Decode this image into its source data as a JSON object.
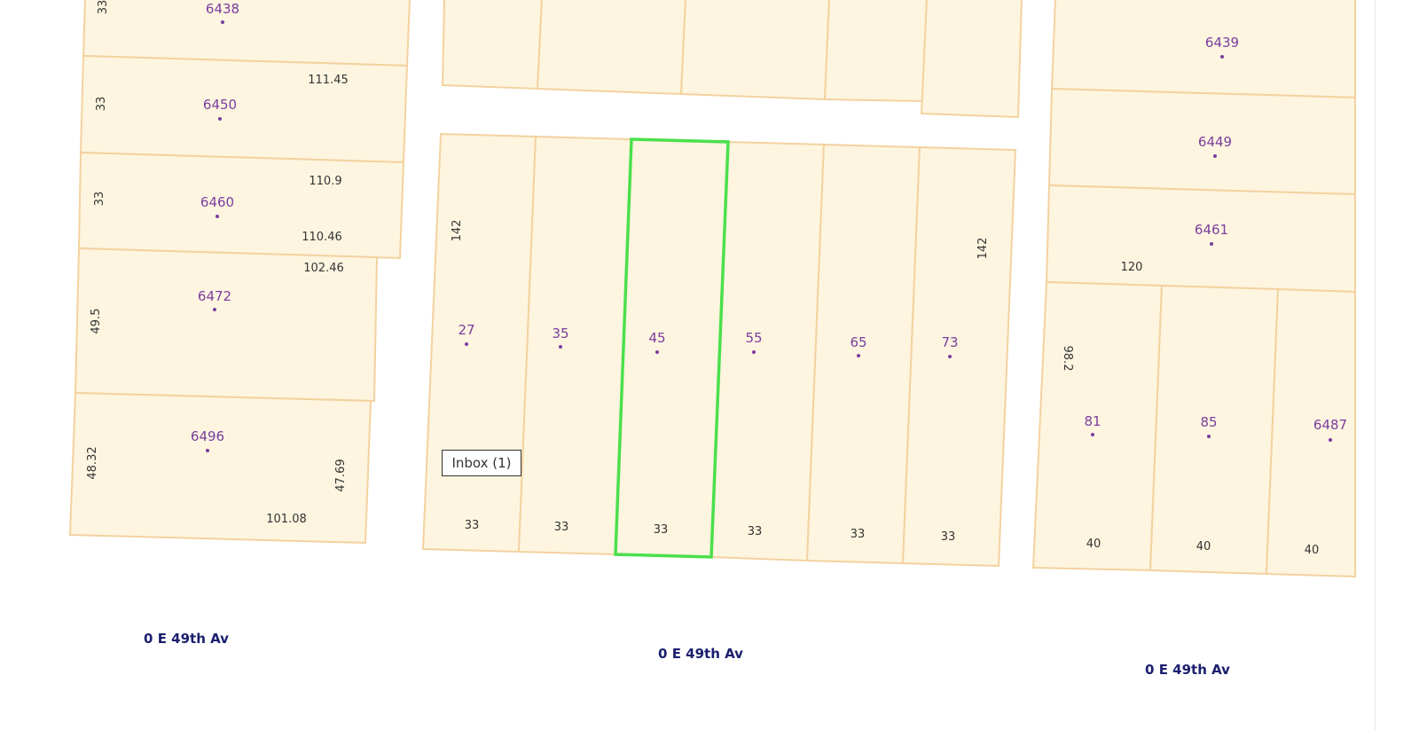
{
  "map": {
    "selected_lot": "45",
    "colors": {
      "lot_fill": "#fdf5e0",
      "lot_border": "#f3d29f",
      "selected_border": "#4be04b",
      "address_text": "#7a3d9e",
      "street_text": "#1b1f6e"
    },
    "address_labels": {
      "a6438": "6438",
      "a6450": "6450",
      "a6460": "6460",
      "a6472": "6472",
      "a6496": "6496",
      "a27": "27",
      "a35": "35",
      "a45": "45",
      "a55": "55",
      "a65": "65",
      "a73": "73",
      "a6439": "6439",
      "a6449": "6449",
      "a6461": "6461",
      "a81": "81",
      "a85": "85",
      "a6487": "6487"
    },
    "dimension_labels": {
      "d33_top": "33",
      "d111_45": "111.45",
      "d33_a": "33",
      "d110_9": "110.9",
      "d33_b": "33",
      "d110_46": "110.46",
      "d102_46": "102.46",
      "d49_5": "49.5",
      "d48_32": "48.32",
      "d47_69": "47.69",
      "d101_08": "101.08",
      "d142_left": "142",
      "d142_right": "142",
      "f33_1": "33",
      "f33_2": "33",
      "f33_3": "33",
      "f33_4": "33",
      "f33_5": "33",
      "f33_6": "33",
      "d120": "120",
      "d98_2": "98.2",
      "f40_1": "40",
      "f40_2": "40",
      "f40_3": "40"
    },
    "streets": {
      "s1": "0 E 49th Av",
      "s2": "0 E 49th Av",
      "s3": "0 E 49th Av"
    }
  },
  "inbox_label": "Inbox (1)"
}
